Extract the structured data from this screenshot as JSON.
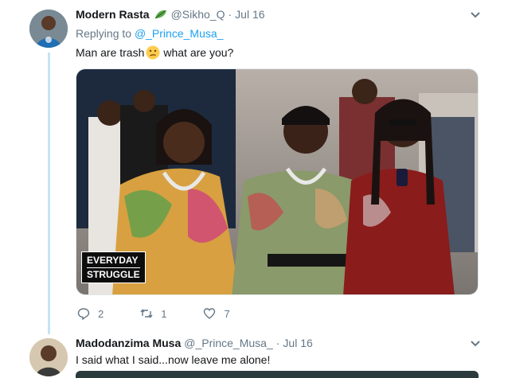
{
  "tweet1": {
    "name": "Modern Rasta",
    "handle": "@Sikho_Q",
    "dot": "·",
    "date": "Jul 16",
    "replying_prefix": "Replying to",
    "replying_to": "@_Prince_Musa_",
    "text_before": "Man are trash",
    "text_after": "what are you?",
    "media": {
      "badge_line1": "EVERYDAY",
      "badge_line2": "STRUGGLE"
    },
    "actions": {
      "replies": "2",
      "retweets": "1",
      "likes": "7"
    }
  },
  "tweet2": {
    "name": "Madodanzima Musa",
    "handle": "@_Prince_Musa_",
    "dot": "·",
    "date": "Jul 16",
    "text": "I said what I said...now leave me alone!"
  },
  "icons": {
    "leaf": "leaf-icon",
    "caret": "chevron-down-icon",
    "reply": "reply-icon",
    "retweet": "retweet-icon",
    "like": "heart-icon",
    "emoji": "confused-face-emoji"
  },
  "colors": {
    "accent": "#1da1f2",
    "muted": "#657786",
    "text": "#14171a",
    "thread_line": "#c4e4f3"
  }
}
